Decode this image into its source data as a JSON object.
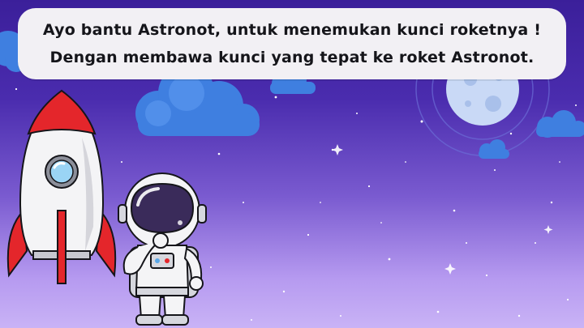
{
  "instruction": {
    "line1": "Ayo bantu Astronot, untuk menemukan kunci roketnya !",
    "line2": "Dengan membawa kunci yang tepat ke roket Astronot."
  },
  "icons": [
    "rocket-icon",
    "astronaut-icon",
    "moon-icon",
    "cloud-icon",
    "star-icon"
  ],
  "colors": {
    "sky_top": "#3b1f9a",
    "sky_bottom": "#c9b3f6",
    "cloud": "#3f7fe0",
    "rocket_red": "#e4262b",
    "rocket_body": "#f4f4f6",
    "text_box": "#f2f0f4"
  }
}
